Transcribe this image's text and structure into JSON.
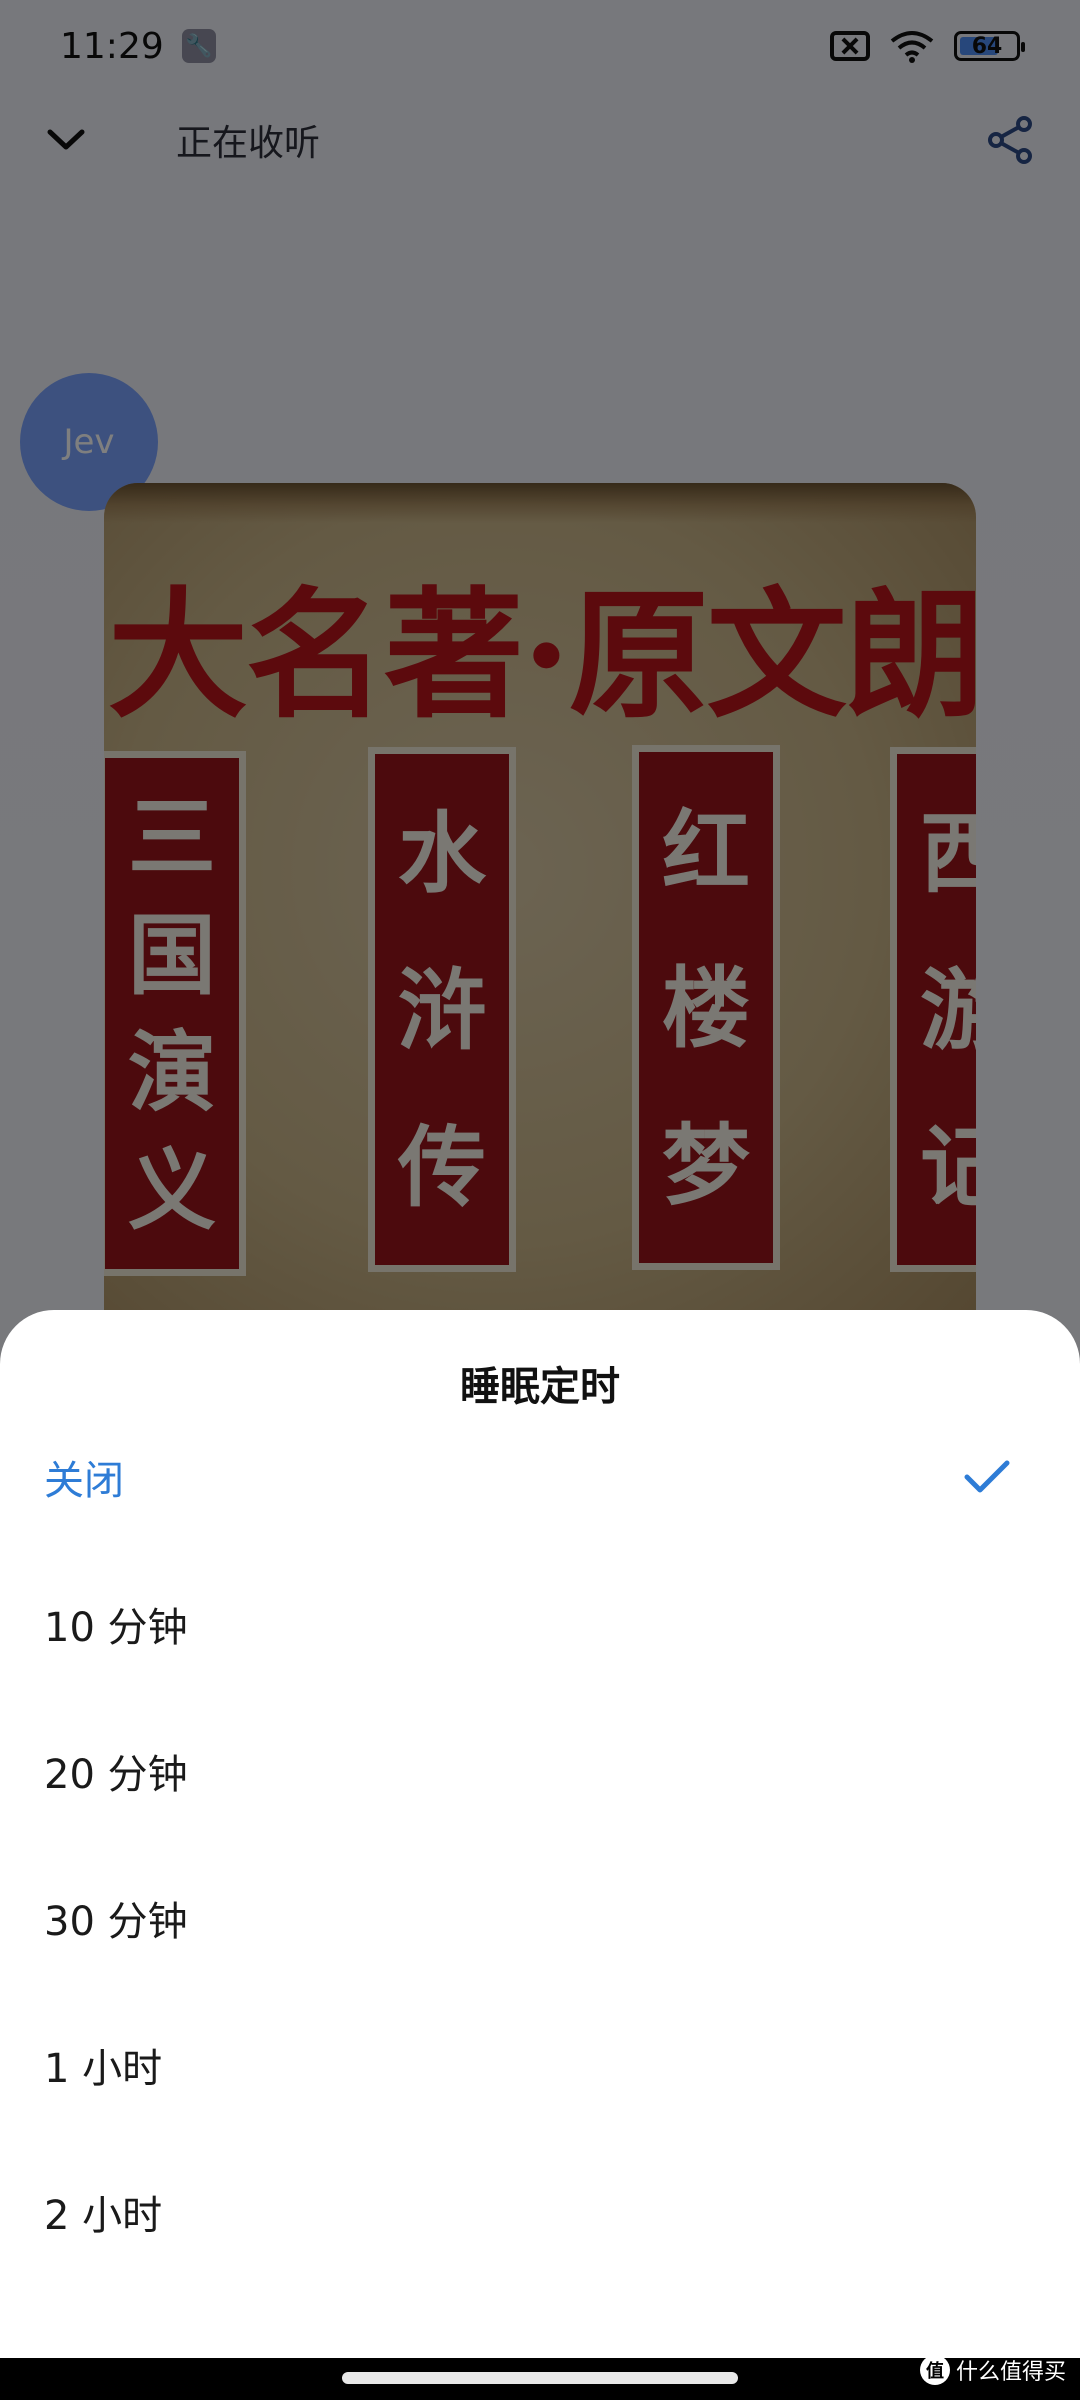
{
  "status_bar": {
    "time": "11:29",
    "tool_icon": "wrench-icon",
    "battery_level": "64",
    "icons": [
      "sim-off-icon",
      "wifi-icon",
      "battery-icon"
    ]
  },
  "header": {
    "collapse_icon": "chevron-down-icon",
    "title": "正在收听",
    "share_icon": "share-icon"
  },
  "avatar": {
    "text": "Jev"
  },
  "cover": {
    "title": "大名著·原文朗",
    "books": [
      {
        "chars": [
          "三",
          "国",
          "演",
          "义"
        ]
      },
      {
        "chars": [
          "水",
          "浒",
          "传"
        ]
      },
      {
        "chars": [
          "红",
          "楼",
          "梦"
        ]
      },
      {
        "chars": [
          "西",
          "游",
          "记"
        ]
      }
    ]
  },
  "sleep_timer": {
    "title": "睡眠定时",
    "selected_index": 0,
    "options": [
      {
        "label": "关闭",
        "selected": true
      },
      {
        "label": "10 分钟",
        "selected": false
      },
      {
        "label": "20 分钟",
        "selected": false
      },
      {
        "label": "30 分钟",
        "selected": false
      },
      {
        "label": "1 小时",
        "selected": false
      },
      {
        "label": "2 小时",
        "selected": false
      }
    ]
  },
  "watermark": {
    "logo": "值",
    "text": "什么值得买"
  },
  "colors": {
    "accent": "#2e7cd6",
    "scrim": "rgba(0,0,0,0.5)",
    "banner_red": "#99141a",
    "title_red": "#b8141a",
    "avatar_blue": "#7aa3ff"
  }
}
